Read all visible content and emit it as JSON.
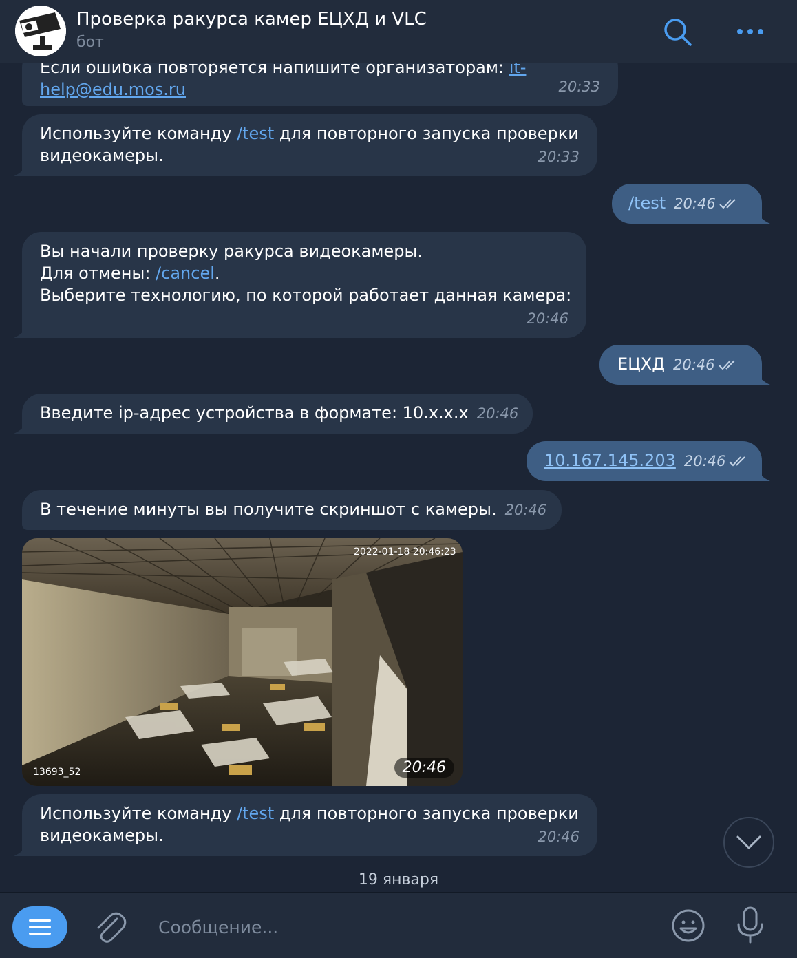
{
  "header": {
    "title": "Проверка ракурса камер ЕЦХД и VLC",
    "subtitle": "бот"
  },
  "messages": {
    "m1": {
      "line1": "Если ошибка повторяется напишите организаторам: ",
      "link_a": "it-",
      "link_b": "help@edu.mos.ru",
      "time": "20:33"
    },
    "m2": {
      "pre": "Используйте команду ",
      "cmd": "/test",
      "post": " для повторного запуска проверки",
      "line2": "видеокамеры.",
      "time": "20:33"
    },
    "m3": {
      "cmd": "/test",
      "time": "20:46"
    },
    "m4": {
      "line1": "Вы начали проверку ракурса видеокамеры.",
      "line2_pre": "Для отмены: ",
      "line2_cmd": "/cancel",
      "line2_post": ".",
      "line3": "Выберите технологию, по которой работает данная камера:",
      "time": "20:46"
    },
    "m5": {
      "text": "ЕЦХД",
      "time": "20:46"
    },
    "m6": {
      "text": "Введите ip-адрес устройства в формате: 10.x.x.x",
      "time": "20:46"
    },
    "m7": {
      "link": "10.167.145.203",
      "time": "20:46"
    },
    "m8": {
      "text": "В течение минуты вы получите скриншот с камеры.",
      "time": "20:46"
    },
    "photo": {
      "overlay_timestamp": "2022-01-18 20:46:23",
      "camera_id": "13693_52",
      "time": "20:46"
    },
    "m9": {
      "pre": "Используйте команду ",
      "cmd": "/test",
      "post": " для повторного запуска проверки",
      "line2": "видеокамеры.",
      "time": "20:46"
    }
  },
  "date_separator": "19 января",
  "input": {
    "placeholder": "Сообщение..."
  },
  "icons": {
    "search": "search-icon",
    "more": "more-dots-icon",
    "menu": "menu-icon",
    "attach": "paperclip-icon",
    "emoji": "emoji-icon",
    "mic": "microphone-icon",
    "scroll": "chevron-down-icon",
    "read": "double-check-icon"
  },
  "colors": {
    "background": "#1c2535",
    "incoming_bubble": "#283548",
    "outgoing_bubble": "#3e5e84",
    "accent": "#4a9cf0",
    "link": "#62a6ed"
  }
}
